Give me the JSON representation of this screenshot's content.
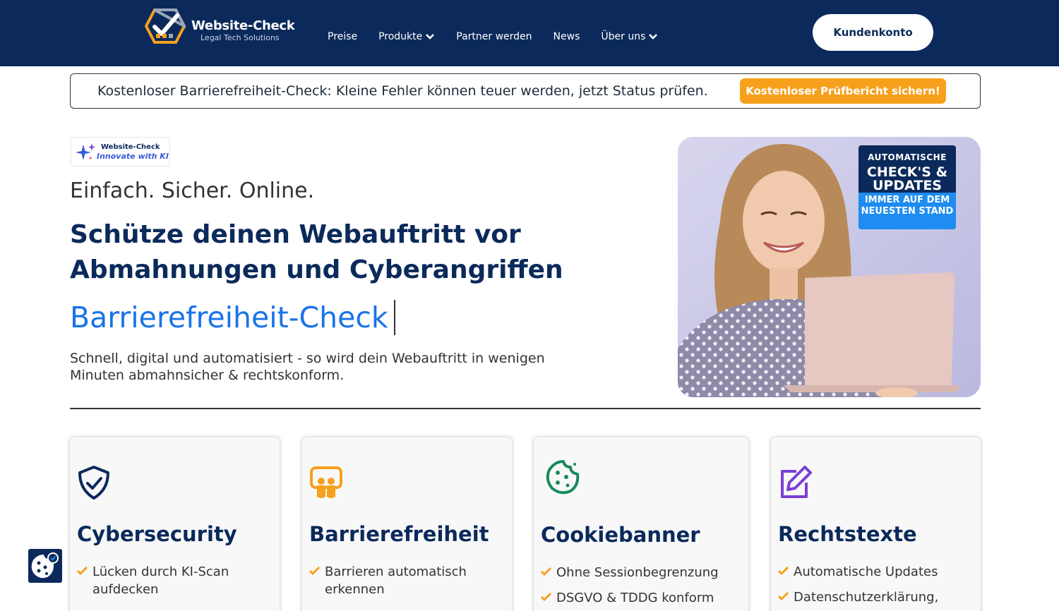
{
  "header": {
    "logo": {
      "title": "Website-Check",
      "subtitle": "Legal Tech Solutions"
    },
    "nav": [
      {
        "label": "Preise",
        "has_dropdown": false
      },
      {
        "label": "Produkte",
        "has_dropdown": true
      },
      {
        "label": "Partner werden",
        "has_dropdown": false
      },
      {
        "label": "News",
        "has_dropdown": false
      },
      {
        "label": "Über uns",
        "has_dropdown": true
      }
    ],
    "account_button": "Kundenkonto"
  },
  "banner": {
    "text": "Kostenloser Barrierefreiheit-Check: Kleine Fehler können teuer werden, jetzt Status prüfen.",
    "button": "Kostenloser Prüfbericht sichern!"
  },
  "hero": {
    "badge": {
      "title": "Website-Check",
      "subtitle": "Innovate with KI"
    },
    "tagline": "Einfach. Sicher. Online.",
    "headline": "Schütze deinen Webauftritt vor Abmahnungen und Cyberangriffen",
    "typed_text": "Barrierefreiheit-Check",
    "lead": "Schnell, digital und automatisiert - so wird dein Webauftritt in wenigen Minuten abmahnsicher & rechtskonform.",
    "promo": {
      "line1": "AUTOMATISCHE",
      "line2": "CHECK'S & UPDATES",
      "line3": "IMMER AUF DEM NEUESTEN STAND"
    }
  },
  "cards": [
    {
      "title": "Cybersecurity",
      "icon": "shield-check-icon",
      "items": [
        "Lücken durch KI-Scan aufdecken"
      ]
    },
    {
      "title": "Barrierefreiheit",
      "icon": "accessibility-icon",
      "items": [
        "Barrieren automatisch erkennen"
      ]
    },
    {
      "title": "Cookiebanner",
      "icon": "cookie-icon",
      "items": [
        "Ohne Sessionbegrenzung",
        "DSGVO & TDDG konform"
      ]
    },
    {
      "title": "Rechtstexte",
      "icon": "edit-icon",
      "items": [
        "Automatische Updates",
        "Datenschutzerklärung,"
      ]
    }
  ],
  "colors": {
    "navy": "#0b2a5b",
    "orange": "#f7a01c",
    "blue": "#1a73e8",
    "green": "#1a8a5a",
    "purple": "#7b3fd6"
  }
}
